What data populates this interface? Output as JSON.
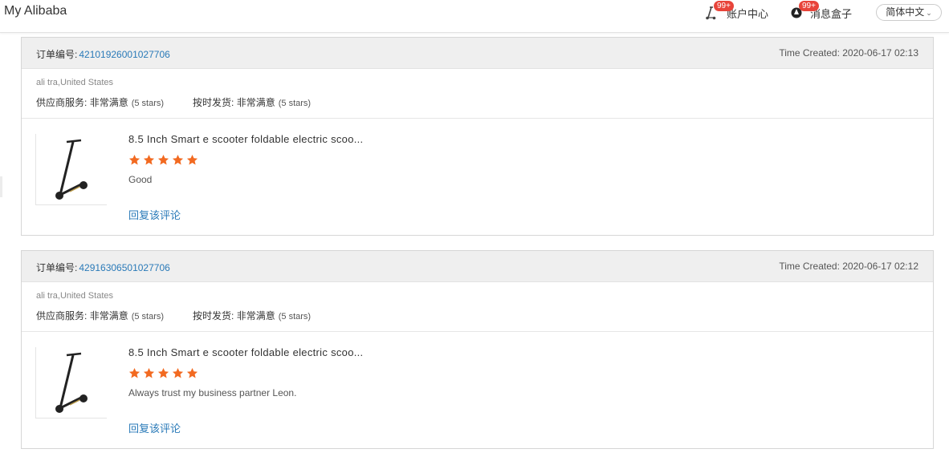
{
  "header": {
    "brand": "My Alibaba",
    "account_center": {
      "label": "账户中心",
      "badge": "99+"
    },
    "message_box": {
      "label": "消息盒子",
      "badge": "99+"
    },
    "language": "简体中文"
  },
  "orders": [
    {
      "order_label": "订单编号:",
      "order_no": "42101926001027706",
      "created": "Time Created: 2020-06-17 02:13",
      "buyer": "ali tra,United States",
      "supplier_service": {
        "label": "供应商服务:",
        "value": "非常满意",
        "stars_text": "(5 stars)"
      },
      "on_time_delivery": {
        "label": "按时发货:",
        "value": "非常满意",
        "stars_text": "(5 stars)"
      },
      "product_title": "8.5 Inch Smart e scooter foldable electric scoo...",
      "rating": 5,
      "comment": "Good",
      "reply_label": "回复该评论"
    },
    {
      "order_label": "订单编号:",
      "order_no": "42916306501027706",
      "created": "Time Created: 2020-06-17 02:12",
      "buyer": "ali tra,United States",
      "supplier_service": {
        "label": "供应商服务:",
        "value": "非常满意",
        "stars_text": "(5 stars)"
      },
      "on_time_delivery": {
        "label": "按时发货:",
        "value": "非常满意",
        "stars_text": "(5 stars)"
      },
      "product_title": "8.5 Inch Smart e scooter foldable electric scoo...",
      "rating": 5,
      "comment": "Always trust my business partner Leon.",
      "reply_label": "回复该评论"
    }
  ],
  "colors": {
    "star": "#f26a21",
    "link": "#2a7ab8",
    "badge": "#e8443a"
  },
  "icons": {
    "star": "star-icon",
    "account": "scooter-icon",
    "message": "message-bell-icon"
  }
}
